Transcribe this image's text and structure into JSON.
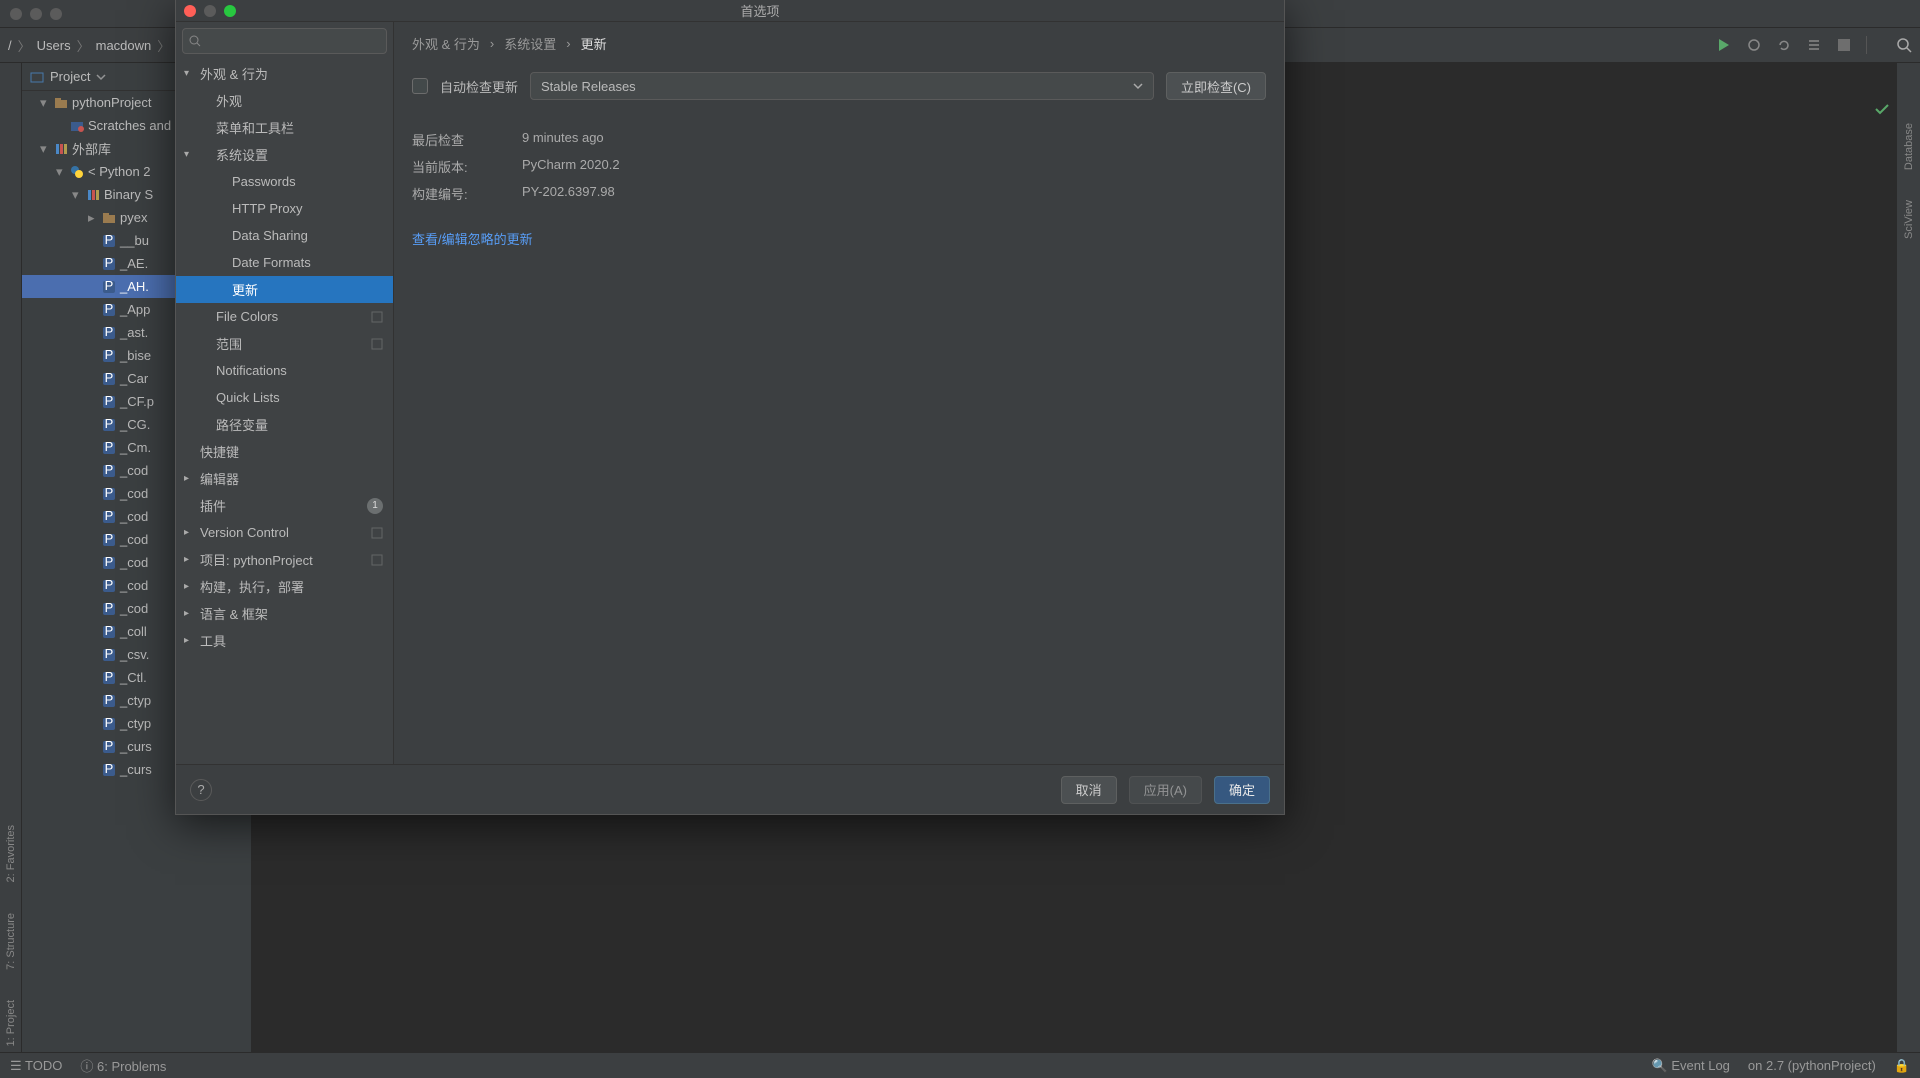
{
  "ide": {
    "breadcrumbs": [
      "/",
      "Users",
      "macdown"
    ],
    "project_label": "Project",
    "toolbar_right_icons": [
      "run-icon",
      "debug-icon",
      "stop-icon",
      "list-icon",
      "search-icon"
    ],
    "left_gutter": [
      "2: Favorites",
      "7: Structure",
      "1: Project"
    ],
    "right_gutter": [
      "Database",
      "SciView"
    ],
    "status": {
      "todo": "TODO",
      "problems": "6: Problems",
      "event_log": "Event Log",
      "interpreter": "on 2.7 (pythonProject)"
    },
    "tree": [
      {
        "depth": 0,
        "icon": "chev-down",
        "kind": "folder",
        "label": "pythonProject"
      },
      {
        "depth": 1,
        "icon": "none",
        "kind": "scratch",
        "label": "Scratches and"
      },
      {
        "depth": 0,
        "icon": "chev-down",
        "kind": "lib",
        "label": "外部库"
      },
      {
        "depth": 1,
        "icon": "chev-down",
        "kind": "py",
        "label": "< Python 2"
      },
      {
        "depth": 2,
        "icon": "chev-down",
        "kind": "lib",
        "label": "Binary S"
      },
      {
        "depth": 3,
        "icon": "chev-right",
        "kind": "folder",
        "label": "pyex"
      },
      {
        "depth": 3,
        "icon": "none",
        "kind": "pyf",
        "label": "__bu"
      },
      {
        "depth": 3,
        "icon": "none",
        "kind": "pyf",
        "label": "_AE."
      },
      {
        "depth": 3,
        "icon": "none",
        "kind": "pyf",
        "label": "_AH.",
        "selected": true
      },
      {
        "depth": 3,
        "icon": "none",
        "kind": "pyf",
        "label": "_App"
      },
      {
        "depth": 3,
        "icon": "none",
        "kind": "pyf",
        "label": "_ast."
      },
      {
        "depth": 3,
        "icon": "none",
        "kind": "pyf",
        "label": "_bise"
      },
      {
        "depth": 3,
        "icon": "none",
        "kind": "pyf",
        "label": "_Car"
      },
      {
        "depth": 3,
        "icon": "none",
        "kind": "pyf",
        "label": "_CF.p"
      },
      {
        "depth": 3,
        "icon": "none",
        "kind": "pyf",
        "label": "_CG."
      },
      {
        "depth": 3,
        "icon": "none",
        "kind": "pyf",
        "label": "_Cm."
      },
      {
        "depth": 3,
        "icon": "none",
        "kind": "pyf",
        "label": "_cod"
      },
      {
        "depth": 3,
        "icon": "none",
        "kind": "pyf",
        "label": "_cod"
      },
      {
        "depth": 3,
        "icon": "none",
        "kind": "pyf",
        "label": "_cod"
      },
      {
        "depth": 3,
        "icon": "none",
        "kind": "pyf",
        "label": "_cod"
      },
      {
        "depth": 3,
        "icon": "none",
        "kind": "pyf",
        "label": "_cod"
      },
      {
        "depth": 3,
        "icon": "none",
        "kind": "pyf",
        "label": "_cod"
      },
      {
        "depth": 3,
        "icon": "none",
        "kind": "pyf",
        "label": "_cod"
      },
      {
        "depth": 3,
        "icon": "none",
        "kind": "pyf",
        "label": "_coll"
      },
      {
        "depth": 3,
        "icon": "none",
        "kind": "pyf",
        "label": "_csv."
      },
      {
        "depth": 3,
        "icon": "none",
        "kind": "pyf",
        "label": "_Ctl."
      },
      {
        "depth": 3,
        "icon": "none",
        "kind": "pyf",
        "label": "_ctyp"
      },
      {
        "depth": 3,
        "icon": "none",
        "kind": "pyf",
        "label": "_ctyp"
      },
      {
        "depth": 3,
        "icon": "none",
        "kind": "pyf",
        "label": "_curs"
      },
      {
        "depth": 3,
        "icon": "none",
        "kind": "pyf",
        "label": "_curs"
      }
    ]
  },
  "dialog": {
    "title": "首选项",
    "search_placeholder": "",
    "nav": [
      {
        "label": "外观 & 行为",
        "depth": 0,
        "arrow": "down"
      },
      {
        "label": "外观",
        "depth": 1
      },
      {
        "label": "菜单和工具栏",
        "depth": 1
      },
      {
        "label": "系统设置",
        "depth": 1,
        "arrow": "down"
      },
      {
        "label": "Passwords",
        "depth": 2
      },
      {
        "label": "HTTP Proxy",
        "depth": 2
      },
      {
        "label": "Data Sharing",
        "depth": 2
      },
      {
        "label": "Date Formats",
        "depth": 2
      },
      {
        "label": "更新",
        "depth": 2,
        "selected": true
      },
      {
        "label": "File Colors",
        "depth": 1,
        "proj": true
      },
      {
        "label": "范围",
        "depth": 1,
        "proj": true
      },
      {
        "label": "Notifications",
        "depth": 1
      },
      {
        "label": "Quick Lists",
        "depth": 1
      },
      {
        "label": "路径变量",
        "depth": 1
      },
      {
        "label": "快捷键",
        "depth": 0
      },
      {
        "label": "编辑器",
        "depth": 0,
        "arrow": "right"
      },
      {
        "label": "插件",
        "depth": 0,
        "badge": "1"
      },
      {
        "label": "Version Control",
        "depth": 0,
        "arrow": "right",
        "proj": true
      },
      {
        "label": "项目: pythonProject",
        "depth": 0,
        "arrow": "right",
        "proj": true
      },
      {
        "label": "构建，执行，部署",
        "depth": 0,
        "arrow": "right"
      },
      {
        "label": "语言 & 框架",
        "depth": 0,
        "arrow": "right"
      },
      {
        "label": "工具",
        "depth": 0,
        "arrow": "right"
      }
    ],
    "crumbs": [
      "外观 & 行为",
      "系统设置",
      "更新"
    ],
    "auto_check_label": "自动检查更新",
    "channel": "Stable Releases",
    "check_now": "立即检查(C)",
    "info": {
      "last_check_label": "最后检查",
      "last_check_value": "9 minutes ago",
      "current_version_label": "当前版本:",
      "current_version_value": "PyCharm 2020.2",
      "build_label": "构建编号:",
      "build_value": "PY-202.6397.98"
    },
    "ignored_link": "查看/编辑忽略的更新",
    "buttons": {
      "cancel": "取消",
      "apply": "应用(A)",
      "ok": "确定"
    }
  }
}
